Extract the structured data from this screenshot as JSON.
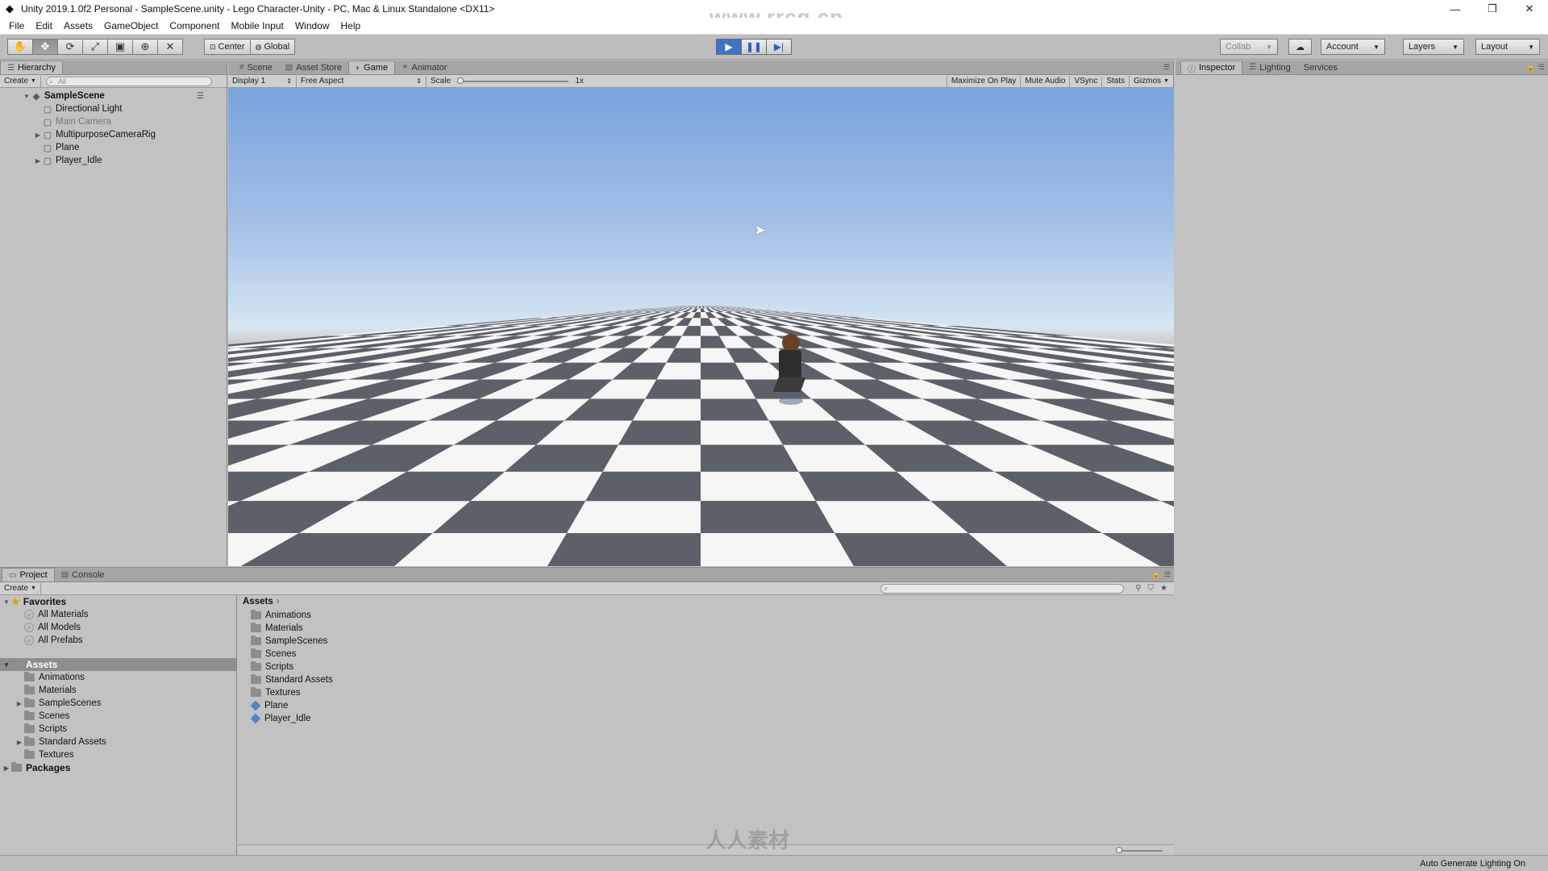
{
  "window": {
    "title": "Unity 2019.1.0f2 Personal - SampleScene.unity - Lego Character-Unity - PC, Mac & Linux Standalone <DX11>",
    "watermark": "www.rrcg.cn",
    "minimize": "—",
    "restore": "❐",
    "close": "✕"
  },
  "menu": [
    "File",
    "Edit",
    "Assets",
    "GameObject",
    "Component",
    "Mobile Input",
    "Window",
    "Help"
  ],
  "toolbar": {
    "tools": [
      "hand-icon",
      "move-icon",
      "rotate-icon",
      "scale-icon",
      "rect-icon",
      "transform-icon",
      "custom-icon"
    ],
    "pivot": "Center",
    "space": "Global",
    "collab": "Collab",
    "account": "Account",
    "layers": "Layers",
    "layout": "Layout",
    "play_active": true
  },
  "hierarchy": {
    "tab": "Hierarchy",
    "create": "Create",
    "search_placeholder": "All",
    "scene": "SampleScene",
    "items": [
      {
        "label": "Directional Light",
        "expandable": false,
        "dim": false
      },
      {
        "label": "Main Camera",
        "expandable": false,
        "dim": true
      },
      {
        "label": "MultipurposeCameraRig",
        "expandable": true,
        "dim": false
      },
      {
        "label": "Plane",
        "expandable": false,
        "dim": false
      },
      {
        "label": "Player_Idle",
        "expandable": true,
        "dim": false
      }
    ]
  },
  "game": {
    "tabs": [
      "Scene",
      "Asset Store",
      "Game",
      "Animator"
    ],
    "active_tab": "Game",
    "display": "Display 1",
    "aspect": "Free Aspect",
    "scale_label": "Scale",
    "scale_value": "1x",
    "maximize": "Maximize On Play",
    "mute": "Mute Audio",
    "vsync": "VSync",
    "stats": "Stats",
    "gizmos": "Gizmos"
  },
  "inspector": {
    "tabs": [
      "Inspector",
      "Lighting",
      "Services"
    ]
  },
  "project": {
    "tabs": [
      "Project",
      "Console"
    ],
    "create": "Create",
    "favorites_header": "Favorites",
    "favorites": [
      "All Materials",
      "All Models",
      "All Prefabs"
    ],
    "assets_header": "Assets",
    "asset_folders": [
      {
        "label": "Animations",
        "expandable": false
      },
      {
        "label": "Materials",
        "expandable": false
      },
      {
        "label": "SampleScenes",
        "expandable": true
      },
      {
        "label": "Scenes",
        "expandable": false
      },
      {
        "label": "Scripts",
        "expandable": false
      },
      {
        "label": "Standard Assets",
        "expandable": true
      },
      {
        "label": "Textures",
        "expandable": false
      }
    ],
    "packages_header": "Packages",
    "breadcrumb": "Assets",
    "content": [
      {
        "label": "Animations",
        "kind": "folder"
      },
      {
        "label": "Materials",
        "kind": "folder"
      },
      {
        "label": "SampleScenes",
        "kind": "folder"
      },
      {
        "label": "Scenes",
        "kind": "folder"
      },
      {
        "label": "Scripts",
        "kind": "folder"
      },
      {
        "label": "Standard Assets",
        "kind": "folder"
      },
      {
        "label": "Textures",
        "kind": "folder"
      },
      {
        "label": "Plane",
        "kind": "prefab"
      },
      {
        "label": "Player_Idle",
        "kind": "prefab"
      }
    ]
  },
  "status": {
    "right": "Auto Generate Lighting On"
  },
  "footer_watermark": "人人素材"
}
